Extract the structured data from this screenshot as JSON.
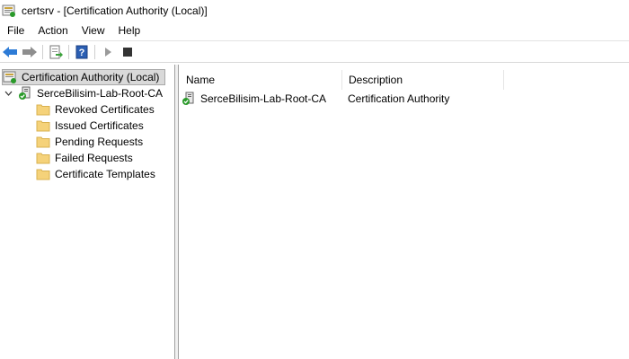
{
  "window": {
    "title": "certsrv - [Certification Authority (Local)]",
    "app_icon": "certsrv-icon"
  },
  "menu": {
    "items": [
      "File",
      "Action",
      "View",
      "Help"
    ]
  },
  "toolbar": {
    "buttons": [
      "back-arrow-icon",
      "forward-arrow-icon",
      "export-list-icon",
      "help-icon",
      "start-service-icon",
      "stop-service-icon"
    ]
  },
  "tree": {
    "root": "Certification Authority (Local)",
    "ca": "SerceBilisim-Lab-Root-CA",
    "children": [
      "Revoked Certificates",
      "Issued Certificates",
      "Pending Requests",
      "Failed Requests",
      "Certificate Templates"
    ]
  },
  "list": {
    "columns": [
      "Name",
      "Description"
    ],
    "rows": [
      {
        "name": "SerceBilisim-Lab-Root-CA",
        "description": "Certification Authority"
      }
    ]
  },
  "colors": {
    "folder": "#f5d27a",
    "folder_dark": "#d9b14f",
    "back_arrow": "#2d7bd6",
    "green_check": "#2a9a2a"
  }
}
